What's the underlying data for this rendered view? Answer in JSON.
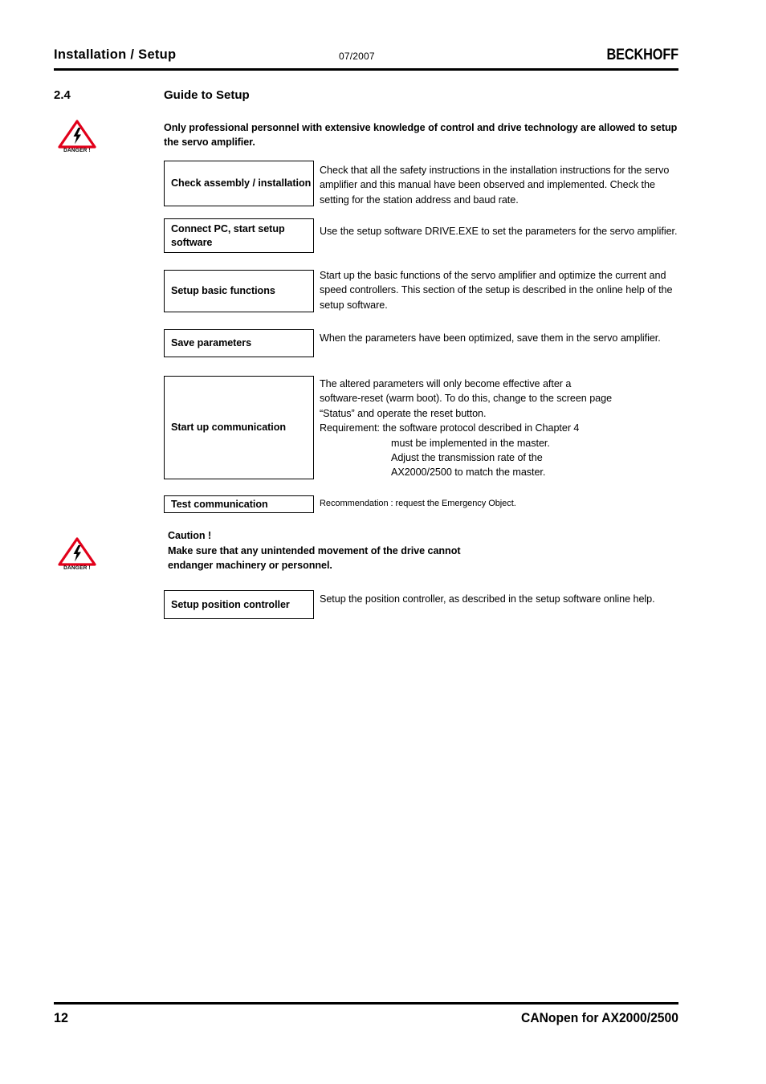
{
  "header": {
    "title": "Installation / Setup",
    "date": "07/2007",
    "logo": "BECKHOFF"
  },
  "section": {
    "number": "2.4",
    "title": "Guide to Setup"
  },
  "danger_icon": {
    "label": "DANGER !",
    "triangle_color": "#e2001a",
    "bolt_color": "#000000"
  },
  "intro": "Only professional personnel with extensive knowledge of control and drive technology are allowed to setup the servo amplifier.",
  "steps": [
    {
      "label": "Check assembly / installation",
      "text": "Check that all the safety instructions in the installation instructions for the servo amplifier and this manual have been observed and implemented. Check the setting for the station address and baud rate."
    },
    {
      "label": "Connect PC, start setup software",
      "text": "Use the setup software DRIVE.EXE to set the parameters for the servo amplifier."
    },
    {
      "label": "Setup basic functions",
      "text": "Start up the basic functions of the servo amplifier and optimize the current and speed controllers. This section of the setup is described in the online help of the setup software."
    },
    {
      "label": "Save parameters",
      "text": "When the parameters have been optimized, save them in the servo amplifier."
    },
    {
      "label": "Start up communication",
      "text_lines": [
        "The altered parameters will only become effective after a",
        "software-reset (warm boot). To do this, change to the screen page",
        "“Status” and operate the reset button.",
        "Requirement: the software protocol described in Chapter 4"
      ],
      "text_indented_lines": [
        "must be implemented in the master.",
        "Adjust the transmission rate of the",
        "AX2000/2500 to match the master."
      ]
    },
    {
      "label": "Test communication",
      "text": "Recommendation : request the Emergency Object."
    },
    {
      "label": "Setup position controller",
      "text": "Setup the position controller, as described in the setup software online help."
    }
  ],
  "caution": {
    "heading": "Caution !",
    "line1": "Make sure that any unintended movement of the drive cannot",
    "line2": "endanger machinery or personnel."
  },
  "footer": {
    "page_number": "12",
    "title": "CANopen for AX2000/2500"
  }
}
